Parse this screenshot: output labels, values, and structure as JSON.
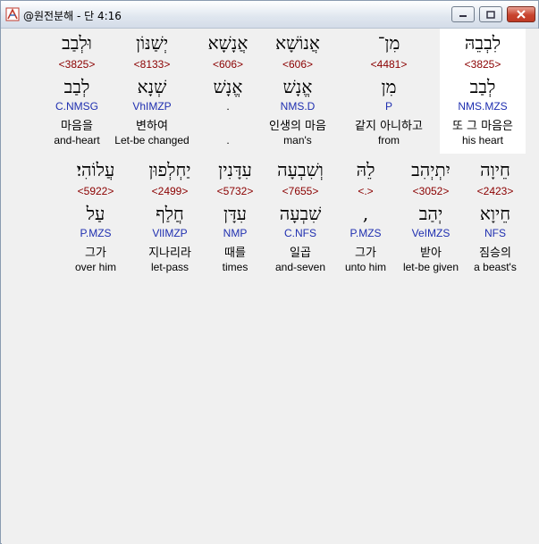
{
  "window": {
    "title": "@원전분해 - 단 4:16"
  },
  "row1": [
    {
      "heb1": "לִבְבֵהּ",
      "strong": "<3825>",
      "heb2": "לְבַב",
      "morph": "NMS.MZS",
      "kor": "또 그 마음은",
      "eng": "his heart"
    },
    {
      "heb1": "מִן־",
      "strong": "<4481>",
      "heb2": "מִן",
      "morph": "P",
      "kor": "같지 아니하고",
      "eng": "from"
    },
    {
      "heb1": "אֲנוֹשָׁא",
      "strong": "<606>",
      "heb2": "אֱנָשׁ",
      "morph": "NMS.D",
      "kor": "인생의 마음",
      "eng": "man's"
    },
    {
      "heb1": "אֲנָשָׁא",
      "strong": "<606>",
      "heb2": "אֱנָשׁ",
      "morph": ".",
      "kor": "",
      "eng": "."
    },
    {
      "heb1": "יְשַׁנּוֹן",
      "strong": "<8133>",
      "heb2": "שְׁנָא",
      "morph": "VhIMZP",
      "kor": "변하여",
      "eng": "Let-be changed"
    },
    {
      "heb1": "וּלְבַב",
      "strong": "<3825>",
      "heb2": "לְבַב",
      "morph": "C.NMSG",
      "kor": "마음을",
      "eng": "and-heart"
    }
  ],
  "row2": [
    {
      "heb1": "חֵיוָה",
      "strong": "<2423>",
      "heb2": "חֵיוָא",
      "morph": "NFS",
      "kor": "짐승의",
      "eng": "a beast's"
    },
    {
      "heb1": "יִתְיְהִב",
      "strong": "<3052>",
      "heb2": "יְהַב",
      "morph": "VeIMZS",
      "kor": "받아",
      "eng": "let-be given"
    },
    {
      "heb1": "לֵהּ",
      "strong": "<.>",
      "heb2": ",",
      "morph": "P.MZS",
      "kor": "그가",
      "eng": "unto him"
    },
    {
      "heb1": "וְשִׁבְעָה",
      "strong": "<7655>",
      "heb2": "שִׁבְעָה",
      "morph": "C.NFS",
      "kor": "일곱",
      "eng": "and-seven"
    },
    {
      "heb1": "עִדָּנִין",
      "strong": "<5732>",
      "heb2": "עִדָּן",
      "morph": "NMP",
      "kor": "때를",
      "eng": "times"
    },
    {
      "heb1": "יַחְלְפוּן",
      "strong": "<2499>",
      "heb2": "חֲלַף",
      "morph": "VlIMZP",
      "kor": "지나리라",
      "eng": "let-pass"
    },
    {
      "heb1": "עֲלוֹהִי׃",
      "strong": "<5922>",
      "heb2": "עַל",
      "morph": "P.MZS",
      "kor": "그가",
      "eng": "over him"
    }
  ]
}
